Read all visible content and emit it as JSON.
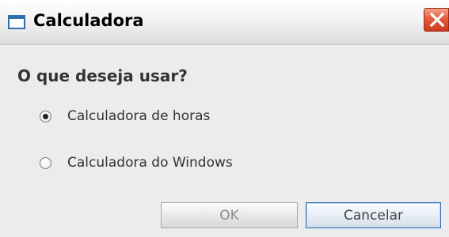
{
  "window": {
    "title": "Calculadora",
    "icon": "window-icon",
    "close_icon": "close-icon"
  },
  "dialog": {
    "question": "O que deseja usar?",
    "options": [
      {
        "label": "Calculadora de horas",
        "selected": true
      },
      {
        "label": "Calculadora do Windows",
        "selected": false
      }
    ],
    "buttons": {
      "ok_label": "OK",
      "ok_enabled": false,
      "cancel_label": "Cancelar"
    }
  },
  "colors": {
    "close_button": "#e45b3b",
    "focus_border": "#2e6fb4",
    "title_icon": "#2f6fb0"
  }
}
